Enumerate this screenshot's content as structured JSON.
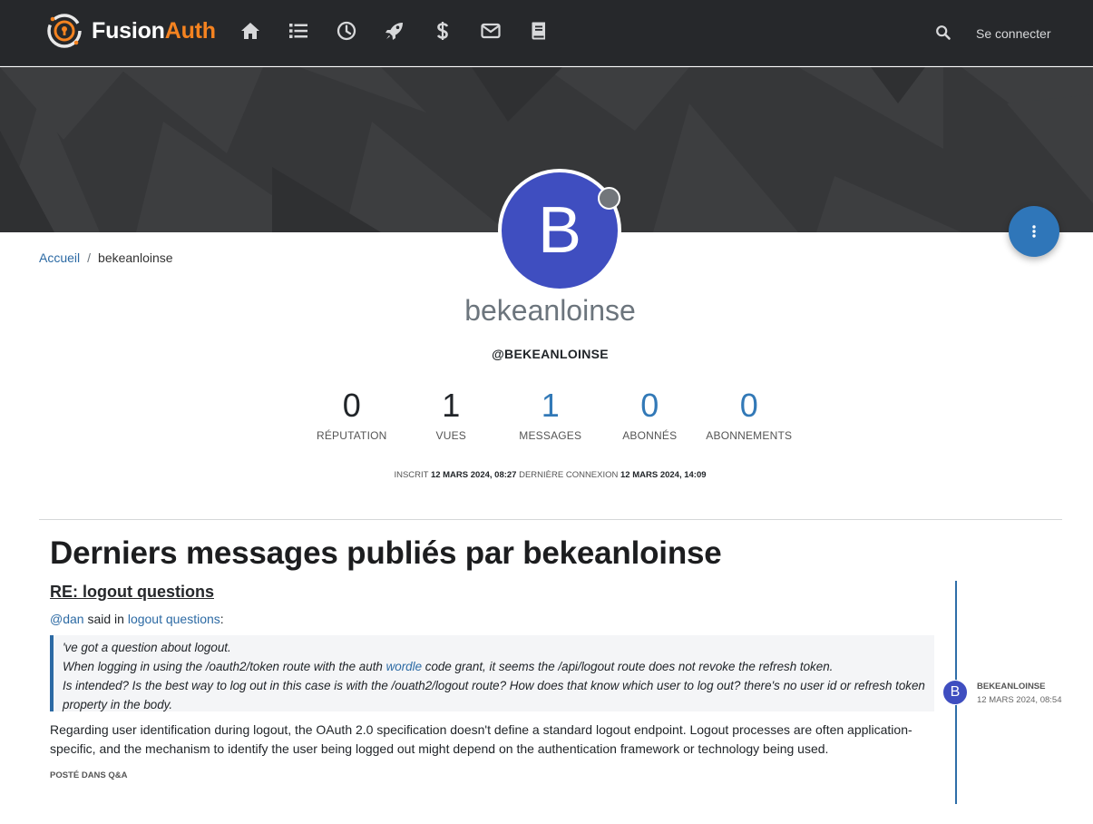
{
  "header": {
    "brand_part1": "Fusion",
    "brand_part2": "Auth",
    "login_label": "Se connecter",
    "nav_icons": [
      "home-icon",
      "list-icon",
      "clock-icon",
      "rocket-icon",
      "dollar-icon",
      "envelope-icon",
      "book-icon",
      "search-icon"
    ]
  },
  "breadcrumb": {
    "home": "Accueil",
    "separator": "/",
    "current": "bekeanloinse"
  },
  "profile": {
    "avatar_letter": "B",
    "avatar_color": "#3f4ec0",
    "status_color": "#72767b",
    "fullname": "bekeanloinse",
    "handle": "@BEKEANLOINSE",
    "stats": [
      {
        "value": "0",
        "label": "Réputation"
      },
      {
        "value": "1",
        "label": "Vues"
      },
      {
        "value": "1",
        "label": "Messages"
      },
      {
        "value": "0",
        "label": "Abonnés"
      },
      {
        "value": "0",
        "label": "Abonnements"
      }
    ],
    "joined_label": "Inscrit",
    "joined_date": "12 mars 2024, 08:27",
    "lastonline_label": "Dernière connexion",
    "lastonline_date": "12 mars 2024, 14:09"
  },
  "posts": {
    "section_title": "Derniers messages publiés par bekeanloinse",
    "items": [
      {
        "title": "RE: logout questions",
        "mention": "@dan",
        "said_in": "said in",
        "topic_link": "logout questions",
        "colon": ":",
        "quote_lines": [
          "'ve got a question about logout.",
          "When logging in using the /oauth2/token route with the auth ",
          "wordle",
          " code grant, it seems the /api/logout route does not revoke the refresh token.",
          "Is intended? Is the best way to log out in this case is with the /ouath2/logout route? How does that know which user to log out? there's no user id or refresh token property in the body."
        ],
        "body": "Regarding user identification during logout, the OAuth 2.0 specification doesn't define a standard logout endpoint. Logout processes are often application-specific, and the mechanism to identify the user being logged out might depend on the authentication framework or technology being used.",
        "posted_in": "Posté dans Q&A",
        "author": "bekeanloinse",
        "author_letter": "B",
        "timestamp": "12 mars 2024, 08:54"
      }
    ]
  },
  "colors": {
    "accent": "#f58320",
    "link": "#2c6aa4",
    "navbar": "#26282b"
  }
}
